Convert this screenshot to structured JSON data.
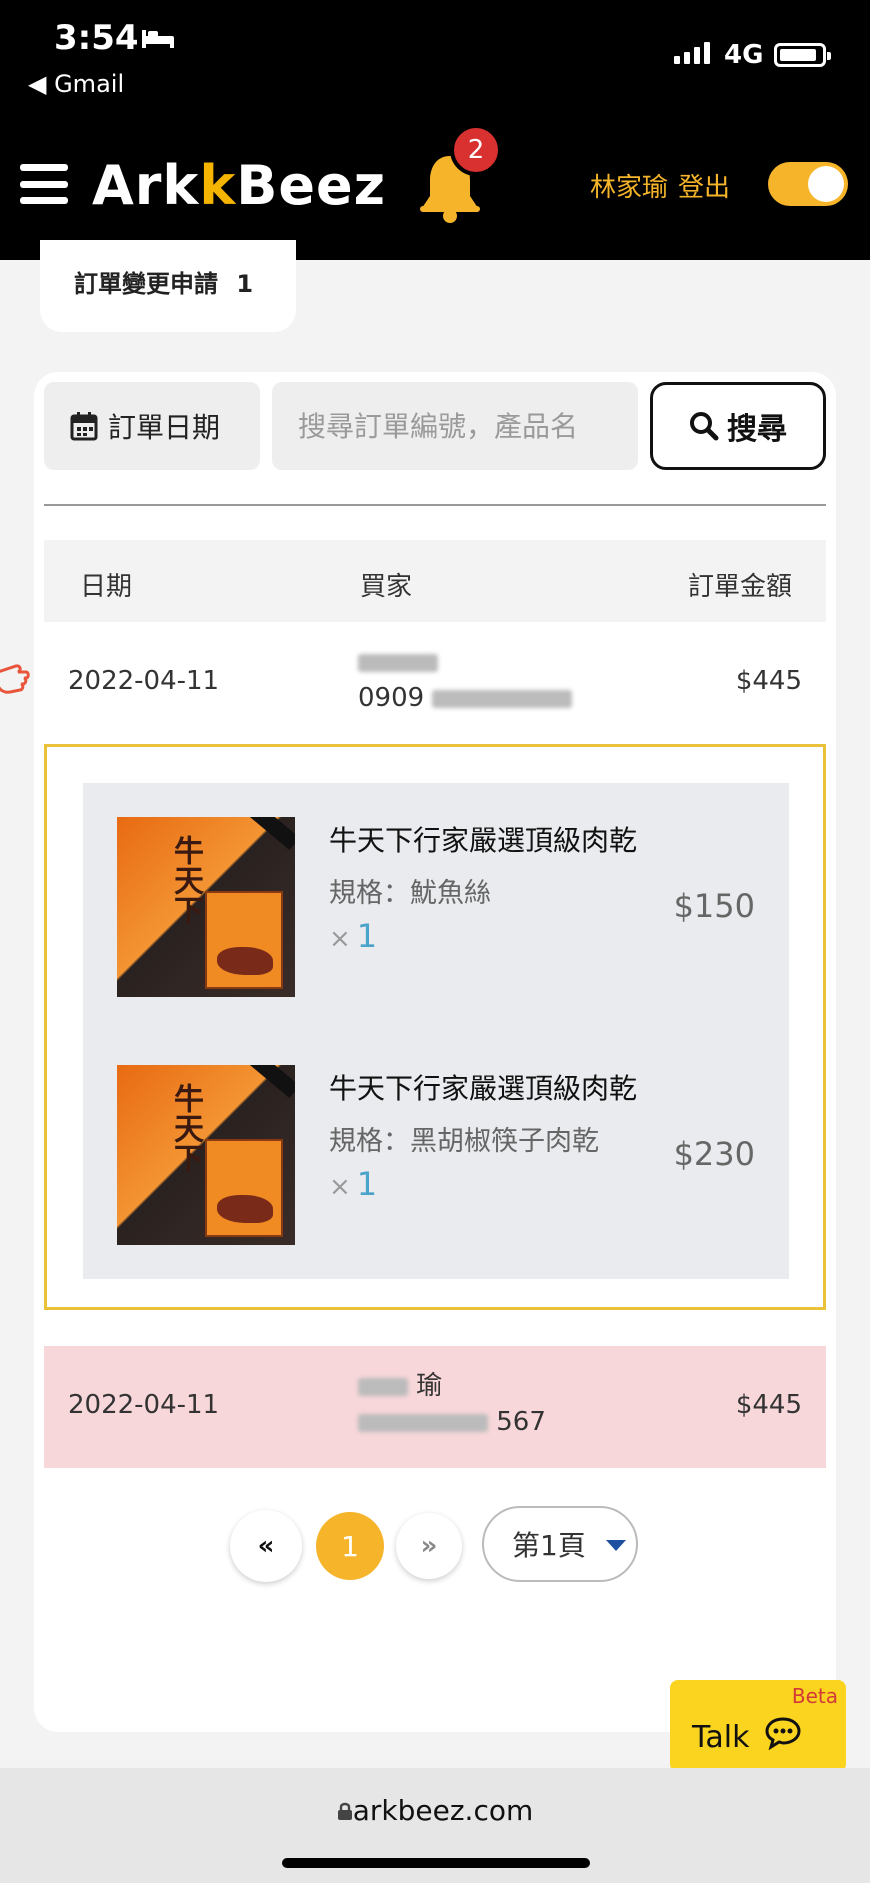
{
  "status_bar": {
    "time": "3:54",
    "back_app": "◀ Gmail",
    "network": "4G"
  },
  "header": {
    "logo_pre": "Ark",
    "logo_k": "k",
    "logo_post": "Beez",
    "notification_count": "2",
    "user_name": "林家瑜",
    "logout_label": "登出"
  },
  "change_request": {
    "label": "訂單變更申請",
    "count": "1"
  },
  "filters": {
    "date_label": "訂單日期",
    "search_placeholder": "搜尋訂單編號，產品名",
    "search_button": "搜尋"
  },
  "table": {
    "headers": {
      "date": "日期",
      "buyer": "買家",
      "amount": "訂單金額"
    },
    "rows": [
      {
        "date": "2022-04-11",
        "buyer_phone_prefix": "0909",
        "amount": "$445"
      },
      {
        "date": "2022-04-11",
        "buyer_name_tail": "瑜",
        "buyer_phone_tail": "567",
        "amount": "$445"
      }
    ]
  },
  "order_items": [
    {
      "name": "牛天下行家嚴選頂級肉乾",
      "spec": "規格：魷魚絲",
      "qty_symbol": "×",
      "qty": "1",
      "price": "$150"
    },
    {
      "name": "牛天下行家嚴選頂級肉乾",
      "spec": "規格：黑胡椒筷子肉乾",
      "qty_symbol": "×",
      "qty": "1",
      "price": "$230"
    }
  ],
  "pagination": {
    "first": "«",
    "current": "1",
    "next": "»",
    "page_select": "第1頁"
  },
  "talk": {
    "label": "Talk",
    "beta": "Beta"
  },
  "browser": {
    "url": "arkbeez.com"
  },
  "colors": {
    "accent": "#f5b42a",
    "highlight_row": "#f8d7da",
    "badge": "#d93030",
    "expand_border": "#e9c23a"
  }
}
